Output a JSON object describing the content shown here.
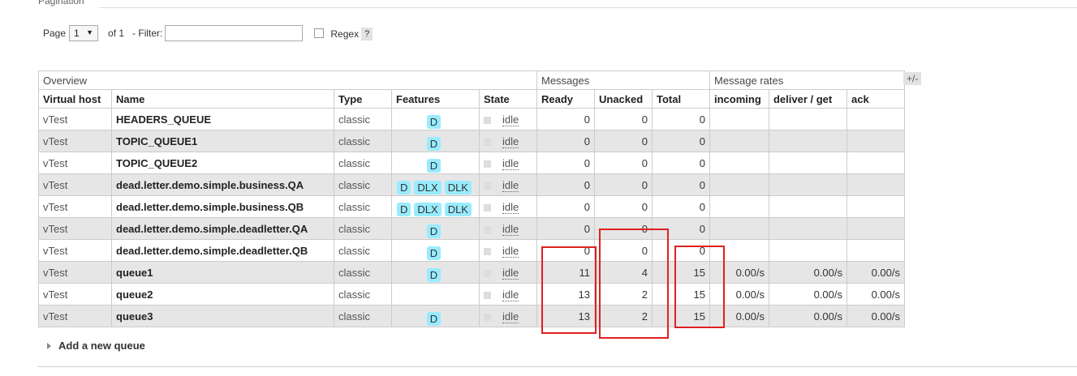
{
  "section_title": "Pagination",
  "pager": {
    "page_label": "Page",
    "page_value": "1",
    "of_label": "of 1",
    "filter_label": "- Filter:",
    "filter_value": "",
    "regex_label": "Regex",
    "help_label": "?"
  },
  "table": {
    "groups": {
      "overview": "Overview",
      "messages": "Messages",
      "rates": "Message rates"
    },
    "columns": [
      "Virtual host",
      "Name",
      "Type",
      "Features",
      "State",
      "Ready",
      "Unacked",
      "Total",
      "incoming",
      "deliver / get",
      "ack"
    ],
    "rows": [
      {
        "vhost": "vTest",
        "name": "HEADERS_QUEUE",
        "type": "classic",
        "features": [
          "D"
        ],
        "state": "idle",
        "ready": "0",
        "unacked": "0",
        "total": "0",
        "incoming": "",
        "deliver": "",
        "ack": ""
      },
      {
        "vhost": "vTest",
        "name": "TOPIC_QUEUE1",
        "type": "classic",
        "features": [
          "D"
        ],
        "state": "idle",
        "ready": "0",
        "unacked": "0",
        "total": "0",
        "incoming": "",
        "deliver": "",
        "ack": ""
      },
      {
        "vhost": "vTest",
        "name": "TOPIC_QUEUE2",
        "type": "classic",
        "features": [
          "D"
        ],
        "state": "idle",
        "ready": "0",
        "unacked": "0",
        "total": "0",
        "incoming": "",
        "deliver": "",
        "ack": ""
      },
      {
        "vhost": "vTest",
        "name": "dead.letter.demo.simple.business.QA",
        "type": "classic",
        "features": [
          "D",
          "DLX",
          "DLK"
        ],
        "state": "idle",
        "ready": "0",
        "unacked": "0",
        "total": "0",
        "incoming": "",
        "deliver": "",
        "ack": ""
      },
      {
        "vhost": "vTest",
        "name": "dead.letter.demo.simple.business.QB",
        "type": "classic",
        "features": [
          "D",
          "DLX",
          "DLK"
        ],
        "state": "idle",
        "ready": "0",
        "unacked": "0",
        "total": "0",
        "incoming": "",
        "deliver": "",
        "ack": ""
      },
      {
        "vhost": "vTest",
        "name": "dead.letter.demo.simple.deadletter.QA",
        "type": "classic",
        "features": [
          "D"
        ],
        "state": "idle",
        "ready": "0",
        "unacked": "0",
        "total": "0",
        "incoming": "",
        "deliver": "",
        "ack": ""
      },
      {
        "vhost": "vTest",
        "name": "dead.letter.demo.simple.deadletter.QB",
        "type": "classic",
        "features": [
          "D"
        ],
        "state": "idle",
        "ready": "0",
        "unacked": "0",
        "total": "0",
        "incoming": "",
        "deliver": "",
        "ack": ""
      },
      {
        "vhost": "vTest",
        "name": "queue1",
        "type": "classic",
        "features": [
          "D"
        ],
        "state": "idle",
        "ready": "11",
        "unacked": "4",
        "total": "15",
        "incoming": "0.00/s",
        "deliver": "0.00/s",
        "ack": "0.00/s"
      },
      {
        "vhost": "vTest",
        "name": "queue2",
        "type": "classic",
        "features": [],
        "state": "idle",
        "ready": "13",
        "unacked": "2",
        "total": "15",
        "incoming": "0.00/s",
        "deliver": "0.00/s",
        "ack": "0.00/s"
      },
      {
        "vhost": "vTest",
        "name": "queue3",
        "type": "classic",
        "features": [
          "D"
        ],
        "state": "idle",
        "ready": "13",
        "unacked": "2",
        "total": "15",
        "incoming": "0.00/s",
        "deliver": "0.00/s",
        "ack": "0.00/s"
      }
    ]
  },
  "columns_toggle": "+/-",
  "add_queue_label": "Add a new queue",
  "colors": {
    "badge": "#99ebff",
    "row_alt": "#e6e6e6",
    "highlight": "#e02020"
  }
}
